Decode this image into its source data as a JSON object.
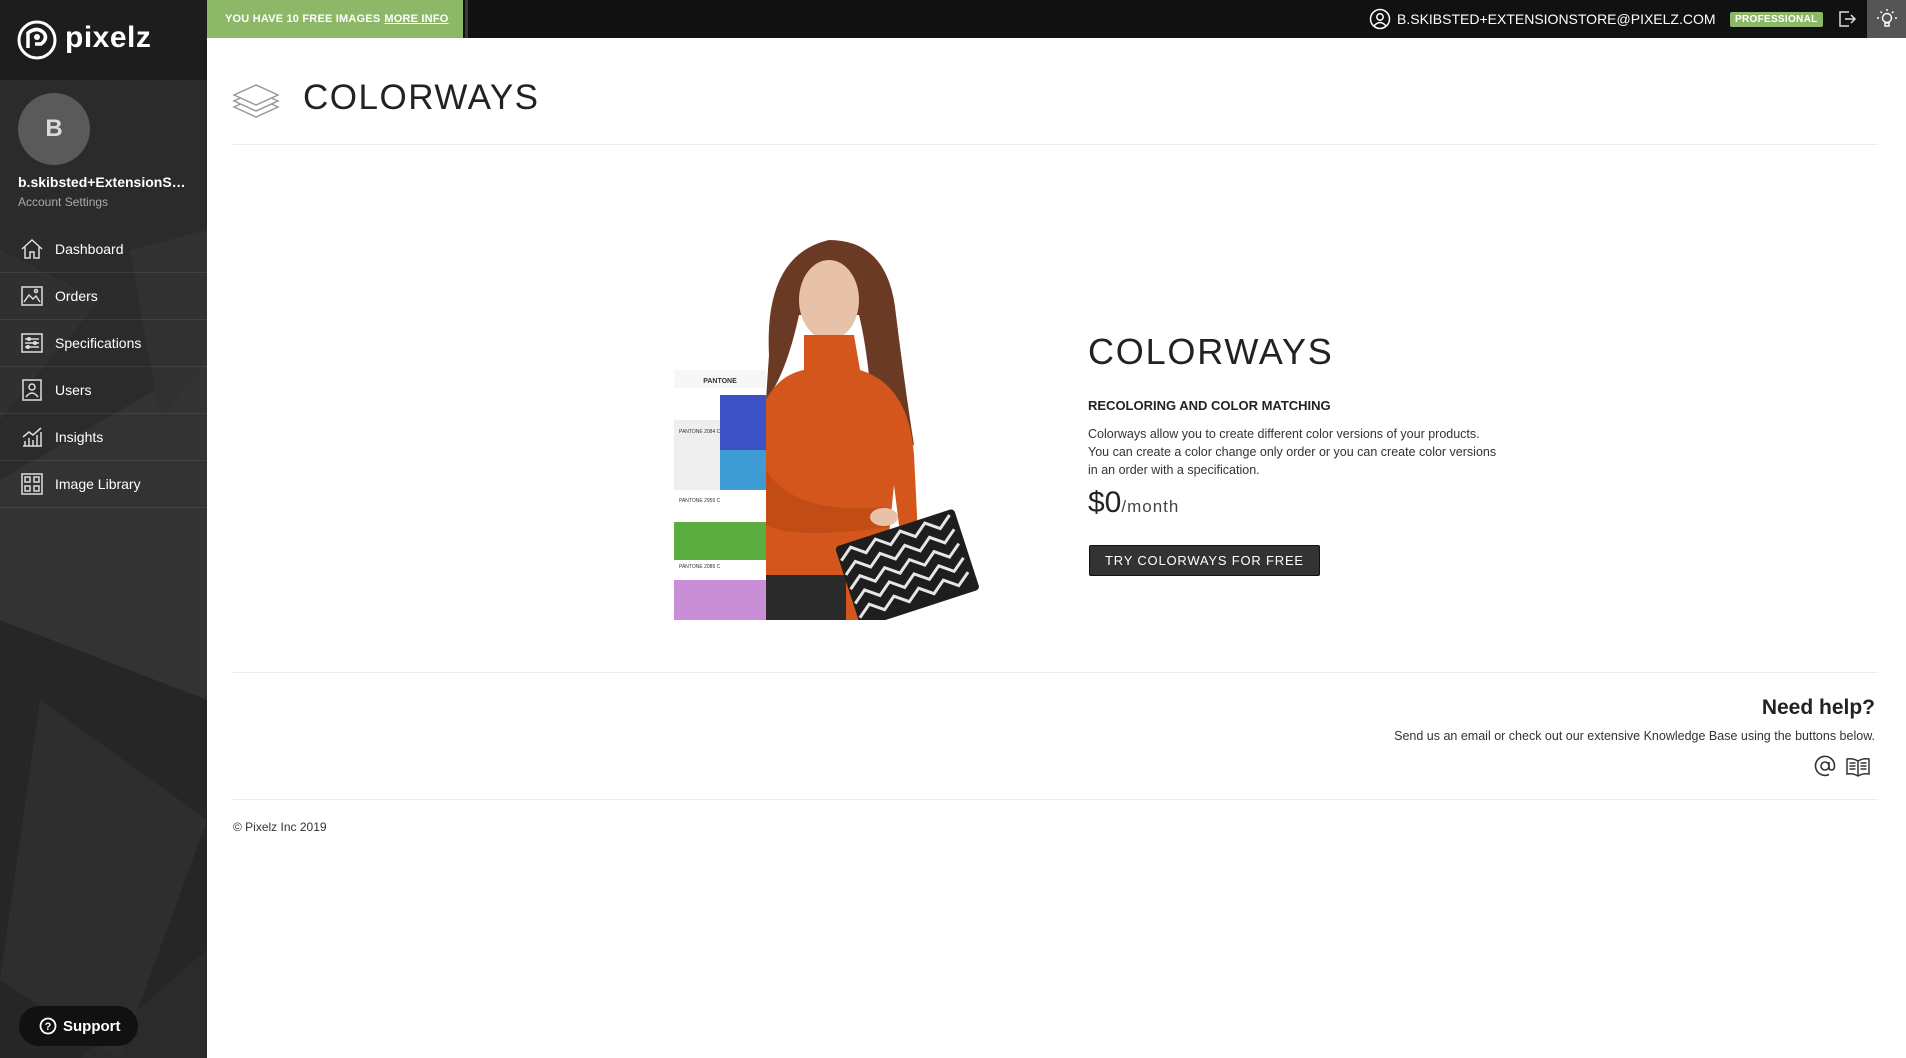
{
  "brand": {
    "name": "pixelz"
  },
  "sidebar": {
    "avatar_initial": "B",
    "user_name": "b.skibsted+ExtensionStore",
    "account_settings": "Account Settings",
    "items": [
      {
        "label": "Dashboard",
        "icon": "home-icon"
      },
      {
        "label": "Orders",
        "icon": "orders-icon"
      },
      {
        "label": "Specifications",
        "icon": "specifications-icon"
      },
      {
        "label": "Users",
        "icon": "users-icon"
      },
      {
        "label": "Insights",
        "icon": "insights-icon"
      },
      {
        "label": "Image Library",
        "icon": "image-library-icon"
      }
    ],
    "support_label": "Support"
  },
  "topbar": {
    "promo_text": "YOU HAVE 10 FREE IMAGES",
    "promo_link": "MORE INFO",
    "user_email": "B.SKIBSTED+EXTENSIONSTORE@PIXELZ.COM",
    "plan_badge": "PROFESSIONAL"
  },
  "page": {
    "title": "COLORWAYS"
  },
  "product": {
    "title": "COLORWAYS",
    "subtitle": "RECOLORING AND COLOR MATCHING",
    "description_lines": [
      "Colorways allow you to create different color versions of your products.",
      "You can create a color change only order or you can create color versions",
      "in an order with a specification."
    ],
    "price": "$0",
    "price_unit": "/month",
    "cta": "TRY COLORWAYS FOR FREE"
  },
  "hero_image": {
    "swatch_header": "PANTONE",
    "swatch_labels": [
      "PANTONE 2084 C",
      "PANTONE 2955 C",
      "PANTONE 2085 C"
    ]
  },
  "help": {
    "title": "Need help?",
    "text": "Send us an email or check out our extensive Knowledge Base using the buttons below."
  },
  "footer": {
    "copyright": "© Pixelz Inc 2019"
  },
  "colors": {
    "sidebar_bg": "#2b2b2b",
    "topbar_bg": "#111111",
    "accent_green": "#8db868",
    "button_dark": "#333333"
  }
}
